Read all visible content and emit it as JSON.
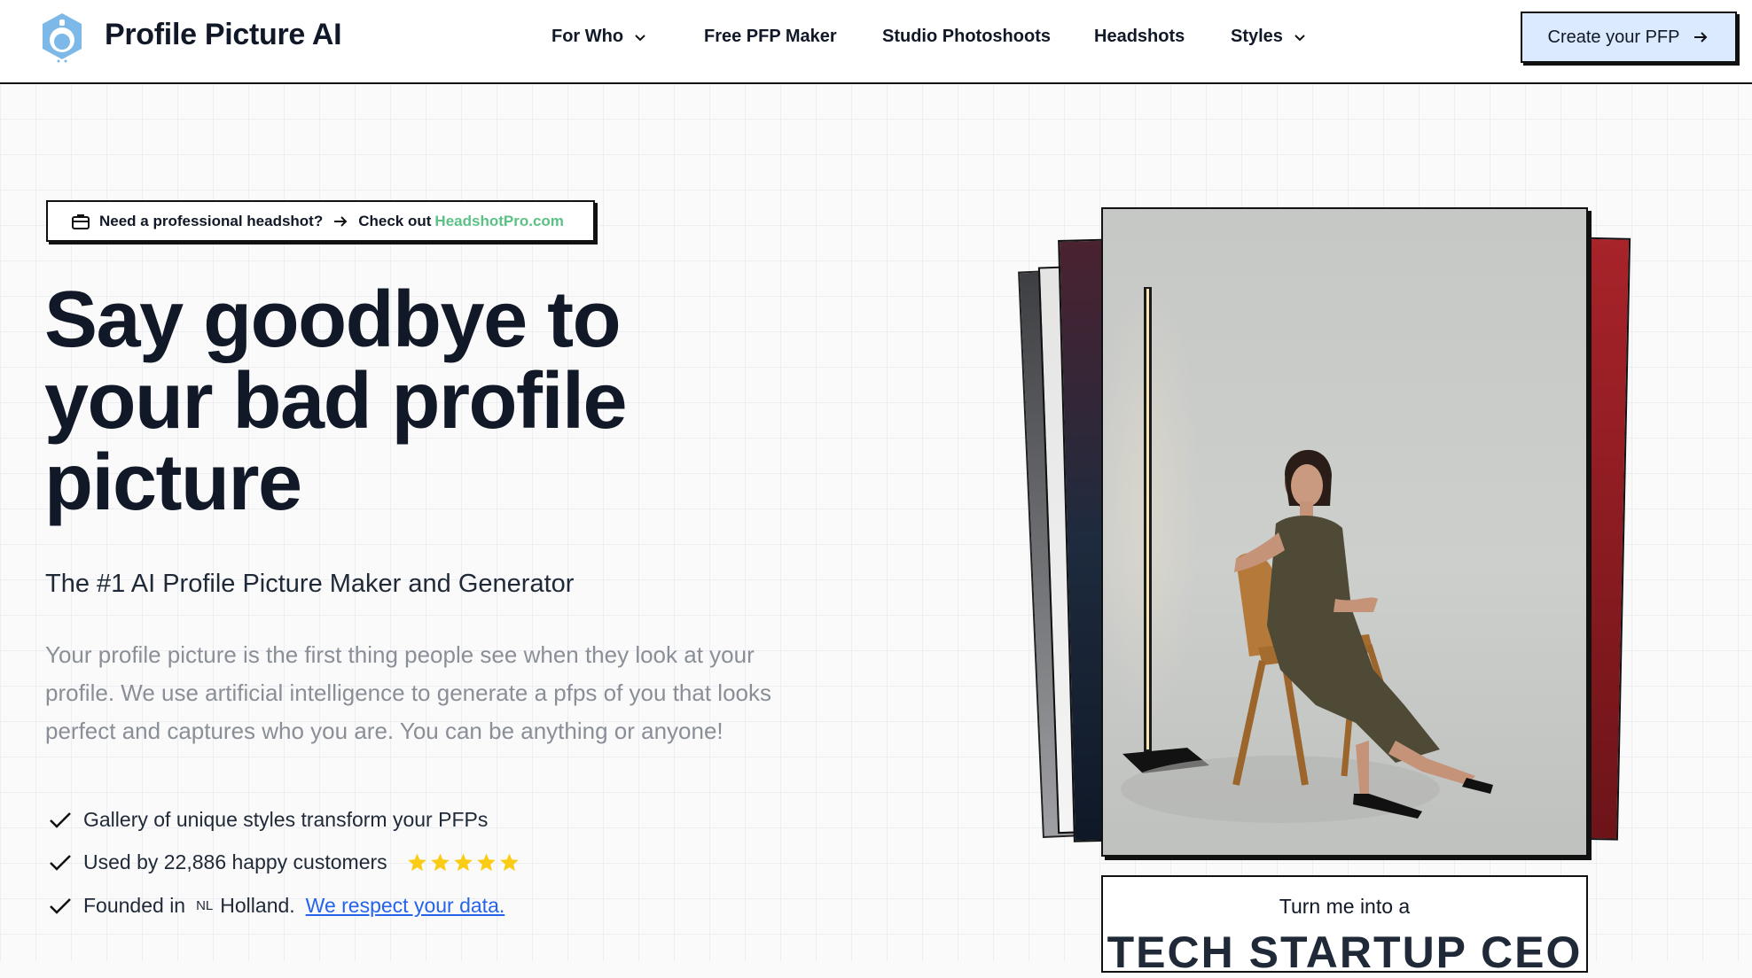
{
  "header": {
    "brand": "Profile Picture AI",
    "nav": [
      {
        "label": "For Who",
        "has_dropdown": true
      },
      {
        "label": "Free PFP Maker",
        "has_dropdown": false
      },
      {
        "label": "Studio Photoshoots",
        "has_dropdown": false
      },
      {
        "label": "Headshots",
        "has_dropdown": false
      },
      {
        "label": "Styles",
        "has_dropdown": true
      }
    ],
    "cta_label": "Create your PFP",
    "logo_icon": "robot-head-logo",
    "cta_icon": "arrow-right-icon"
  },
  "notice": {
    "icon": "briefcase-icon",
    "question": "Need a professional headshot?",
    "check_out": "Check out",
    "link_text": "HeadshotPro.com"
  },
  "hero": {
    "title_lines": [
      "Say goodbye to",
      "your bad profile",
      "picture"
    ],
    "subtitle": "The #1 AI Profile Picture Maker and Generator",
    "description": "Your profile picture is the first thing people see when they look at your profile. We use artificial intelligence to generate a pfps of you that looks perfect and captures who you are. You can be anything or anyone!",
    "features": [
      {
        "text": "Gallery of unique styles transform your PFPs"
      },
      {
        "text": "Used by 22,886 happy customers",
        "stars": 5
      },
      {
        "prefix": "Founded in",
        "flag": "NL",
        "country": "Holland.",
        "link": "We respect your data."
      }
    ]
  },
  "showcase": {
    "caption_small": "Turn me into a",
    "caption_big": "TECH STARTUP CEO"
  },
  "colors": {
    "accent_green": "#5cc184",
    "cta_bg": "#dbeafe",
    "star": "#facc15",
    "link": "#2563eb"
  }
}
